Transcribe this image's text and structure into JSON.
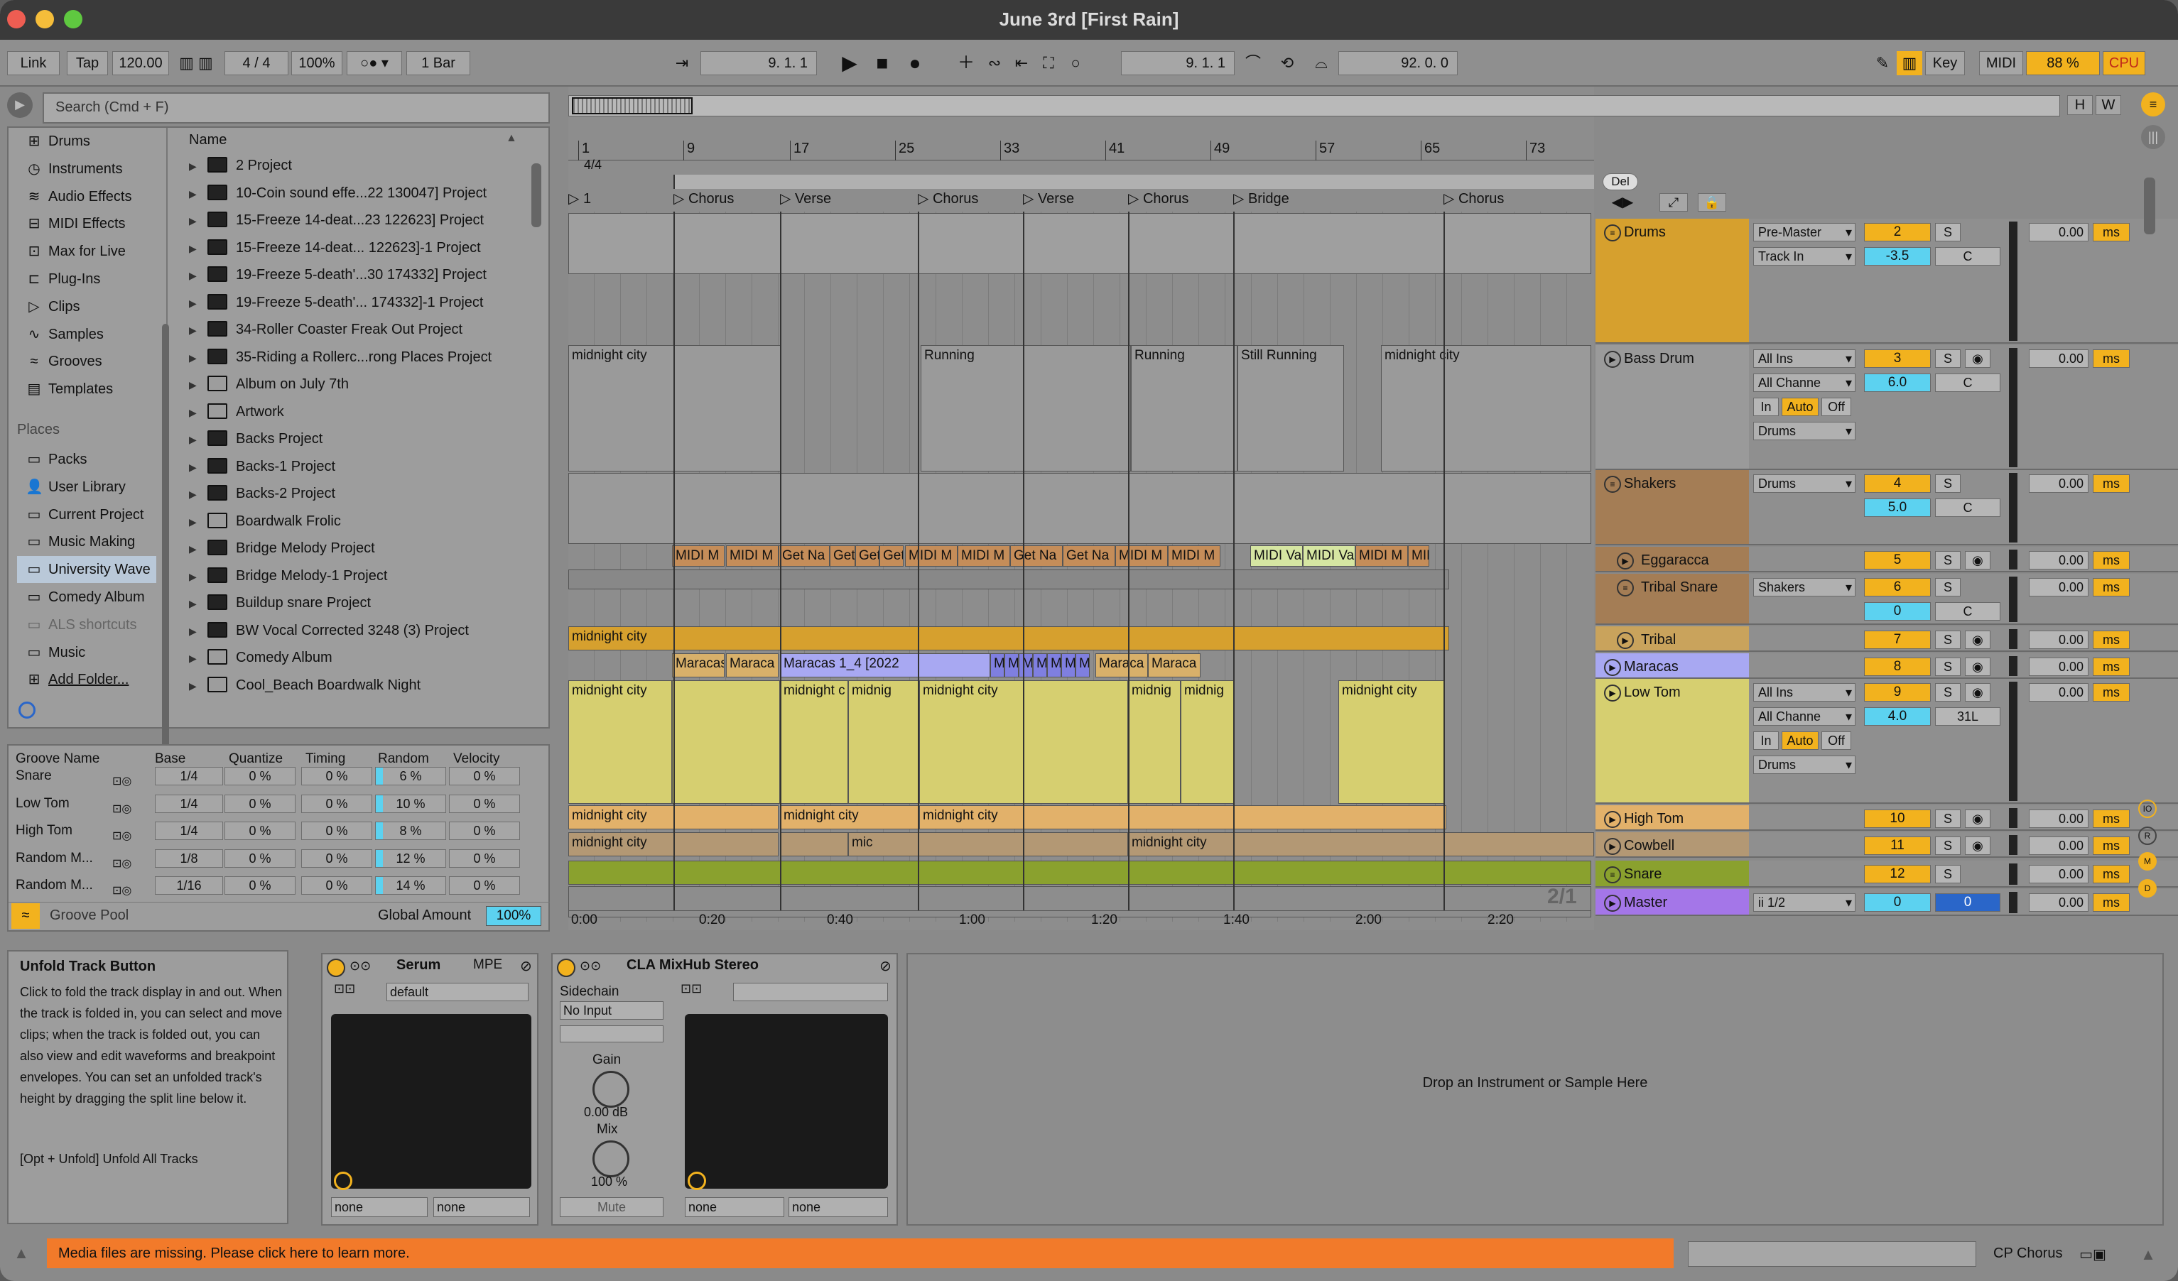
{
  "window": {
    "title": "June 3rd  [First Rain]"
  },
  "transport": {
    "link": "Link",
    "tap": "Tap",
    "tempo": "120.00",
    "signature": "4 / 4",
    "zoom": "100%",
    "quantize": "1 Bar",
    "position": "9.  1.  1",
    "loop_start": "9.  1.  1",
    "loop_length": "92.  0.  0",
    "key": "Key",
    "midi": "MIDI",
    "cpu_value": "88 %",
    "cpu": "CPU"
  },
  "browser": {
    "search_placeholder": "Search (Cmd + F)",
    "categories": [
      {
        "label": "Drums",
        "icon": "grid-icon"
      },
      {
        "label": "Instruments",
        "icon": "clock-icon"
      },
      {
        "label": "Audio Effects",
        "icon": "waves-icon"
      },
      {
        "label": "MIDI Effects",
        "icon": "keys-icon"
      },
      {
        "label": "Max for Live",
        "icon": "box-icon"
      },
      {
        "label": "Plug-Ins",
        "icon": "plug-icon"
      },
      {
        "label": "Clips",
        "icon": "play-icon"
      },
      {
        "label": "Samples",
        "icon": "wave-icon"
      },
      {
        "label": "Grooves",
        "icon": "squiggle-icon"
      },
      {
        "label": "Templates",
        "icon": "template-icon"
      }
    ],
    "places_heading": "Places",
    "places": [
      {
        "label": "Packs",
        "icon": "folder-icon"
      },
      {
        "label": "User Library",
        "icon": "user-icon"
      },
      {
        "label": "Current Project",
        "icon": "folder-icon"
      },
      {
        "label": "Music Making",
        "icon": "folder-icon"
      },
      {
        "label": "University Wave",
        "icon": "folder-icon"
      },
      {
        "label": "Comedy Album",
        "icon": "folder-icon"
      },
      {
        "label": "ALS shortcuts",
        "icon": "folder-icon"
      },
      {
        "label": "Music",
        "icon": "folder-icon"
      },
      {
        "label": "Add Folder...",
        "icon": "plus-icon"
      }
    ],
    "name_header": "Name",
    "files": [
      "2 Project",
      "10-Coin sound effe...22 130047] Project",
      "15-Freeze 14-deat...23 122623] Project",
      "15-Freeze 14-deat... 122623]-1 Project",
      "19-Freeze 5-death'...30 174332] Project",
      "19-Freeze 5-death'... 174332]-1 Project",
      "34-Roller Coaster Freak Out Project",
      "35-Riding a Rollerc...rong Places Project",
      "Album on July 7th",
      "Artwork",
      "Backs Project",
      "Backs-1 Project",
      "Backs-2 Project",
      "Boardwalk Frolic",
      "Bridge Melody Project",
      "Bridge Melody-1 Project",
      "Buildup snare Project",
      "BW Vocal Corrected 3248 (3) Project",
      "Comedy Album",
      "Cool_Beach Boardwalk Night"
    ]
  },
  "groove": {
    "headers": [
      "Groove Name",
      "Base",
      "Quantize",
      "Timing",
      "Random",
      "Velocity"
    ],
    "rows": [
      {
        "name": "Snare",
        "base": "1/4",
        "quantize": "0 %",
        "timing": "0 %",
        "random": "6 %",
        "velocity": "0 %"
      },
      {
        "name": "Low Tom",
        "base": "1/4",
        "quantize": "0 %",
        "timing": "0 %",
        "random": "10 %",
        "velocity": "0 %"
      },
      {
        "name": "High Tom",
        "base": "1/4",
        "quantize": "0 %",
        "timing": "0 %",
        "random": "8 %",
        "velocity": "0 %"
      },
      {
        "name": "Random M...",
        "base": "1/8",
        "quantize": "0 %",
        "timing": "0 %",
        "random": "12 %",
        "velocity": "0 %"
      },
      {
        "name": "Random M...",
        "base": "1/16",
        "quantize": "0 %",
        "timing": "0 %",
        "random": "14 %",
        "velocity": "0 %"
      }
    ],
    "pool": "Groove Pool",
    "global_amount_label": "Global Amount",
    "global_amount": "100%"
  },
  "arrangement": {
    "bars": [
      "1",
      "9",
      "17",
      "25",
      "33",
      "41",
      "49",
      "57",
      "65",
      "73"
    ],
    "time_sig": "4/4",
    "locators": [
      "1",
      "Chorus",
      "Verse",
      "Chorus",
      "Verse",
      "Chorus",
      "Bridge",
      "Chorus"
    ],
    "times": [
      "0:00",
      "0:20",
      "0:40",
      "1:00",
      "1:20",
      "1:40",
      "2:00",
      "2:20"
    ],
    "ratio": "2/1",
    "del": "Del",
    "h": "H",
    "w": "W",
    "clips": {
      "midnight": "midnight city",
      "running": "Running",
      "still_running": "Still Running",
      "midi_m": "MIDI M",
      "get_na": "Get Na",
      "get": "Get",
      "midi_va": "MIDI Va",
      "mid": "MID",
      "maracas": "Maracas",
      "maracas_long": "Maracas 1_4 [2022",
      "m": "M",
      "maraca": "Maraca",
      "midnight_c": "midnight c",
      "midnig": "midnig",
      "mic": "mic",
      "midnight_city2": "midnight city"
    }
  },
  "tracks": [
    {
      "name": "Drums",
      "color": "#d6a02e",
      "in1": "Pre-Master",
      "in2": "Track In",
      "num": "2",
      "vol": "-3.5",
      "pan": "C",
      "delay": "0.00"
    },
    {
      "name": "Bass Drum",
      "color": "#9a9a9a",
      "in1": "All Ins",
      "in2": "All Channe",
      "num": "3",
      "vol": "6.0",
      "pan": "C",
      "delay": "0.00",
      "monitor": [
        "In",
        "Auto",
        "Off"
      ],
      "out": "Drums"
    },
    {
      "name": "Shakers",
      "color": "#a47d55",
      "in1": "Drums",
      "num": "4",
      "vol": "5.0",
      "pan": "C",
      "delay": "0.00"
    },
    {
      "name": "Eggaracca",
      "color": "#a47d55",
      "num": "5",
      "delay": "0.00"
    },
    {
      "name": "Tribal Snare",
      "color": "#a47d55",
      "in1": "Shakers",
      "num": "6",
      "vol": "0",
      "pan": "C",
      "delay": "0.00"
    },
    {
      "name": "Tribal",
      "color": "#c9a35c",
      "num": "7",
      "delay": "0.00"
    },
    {
      "name": "Maracas",
      "color": "#a8a8f2",
      "num": "8",
      "delay": "0.00"
    },
    {
      "name": "Low Tom",
      "color": "#d6cf70",
      "in1": "All Ins",
      "in2": "All Channe",
      "num": "9",
      "vol": "4.0",
      "pan": "31L",
      "delay": "0.00",
      "monitor": [
        "In",
        "Auto",
        "Off"
      ],
      "out": "Drums"
    },
    {
      "name": "High Tom",
      "color": "#e2b16a",
      "num": "10",
      "delay": "0.00"
    },
    {
      "name": "Cowbell",
      "color": "#b39874",
      "num": "11",
      "delay": "0.00"
    },
    {
      "name": "Snare",
      "color": "#8aa12e",
      "num": "12",
      "delay": "0.00"
    },
    {
      "name": "Master",
      "color": "#a476e8",
      "in1": "ii 1/2",
      "num": "0",
      "vol": "0",
      "delay": "0.00"
    }
  ],
  "mixer_labels": {
    "s": "S",
    "ms": "ms"
  },
  "info": {
    "title": "Unfold Track Button",
    "body": "Click to fold the track display in and out. When the track is folded in, you can select and move clips; when the track is folded out, you can also view and edit waveforms and breakpoint envelopes. You can set an unfolded track's height by dragging the split line below it.",
    "shortcut": "[Opt + Unfold] Unfold All Tracks"
  },
  "devices": {
    "serum": {
      "name": "Serum",
      "mpe": "MPE",
      "preset": "default",
      "none1": "none",
      "none2": "none"
    },
    "mixhub": {
      "name": "CLA MixHub Stereo",
      "sidechain": "Sidechain",
      "input": "No Input",
      "gain_label": "Gain",
      "gain": "0.00 dB",
      "mix_label": "Mix",
      "mix": "100 %",
      "mute": "Mute",
      "none1": "none",
      "none2": "none"
    },
    "drop": "Drop an Instrument or Sample Here"
  },
  "status": {
    "message": "Media files are missing. Please click here to learn more.",
    "right": "CP Chorus"
  }
}
